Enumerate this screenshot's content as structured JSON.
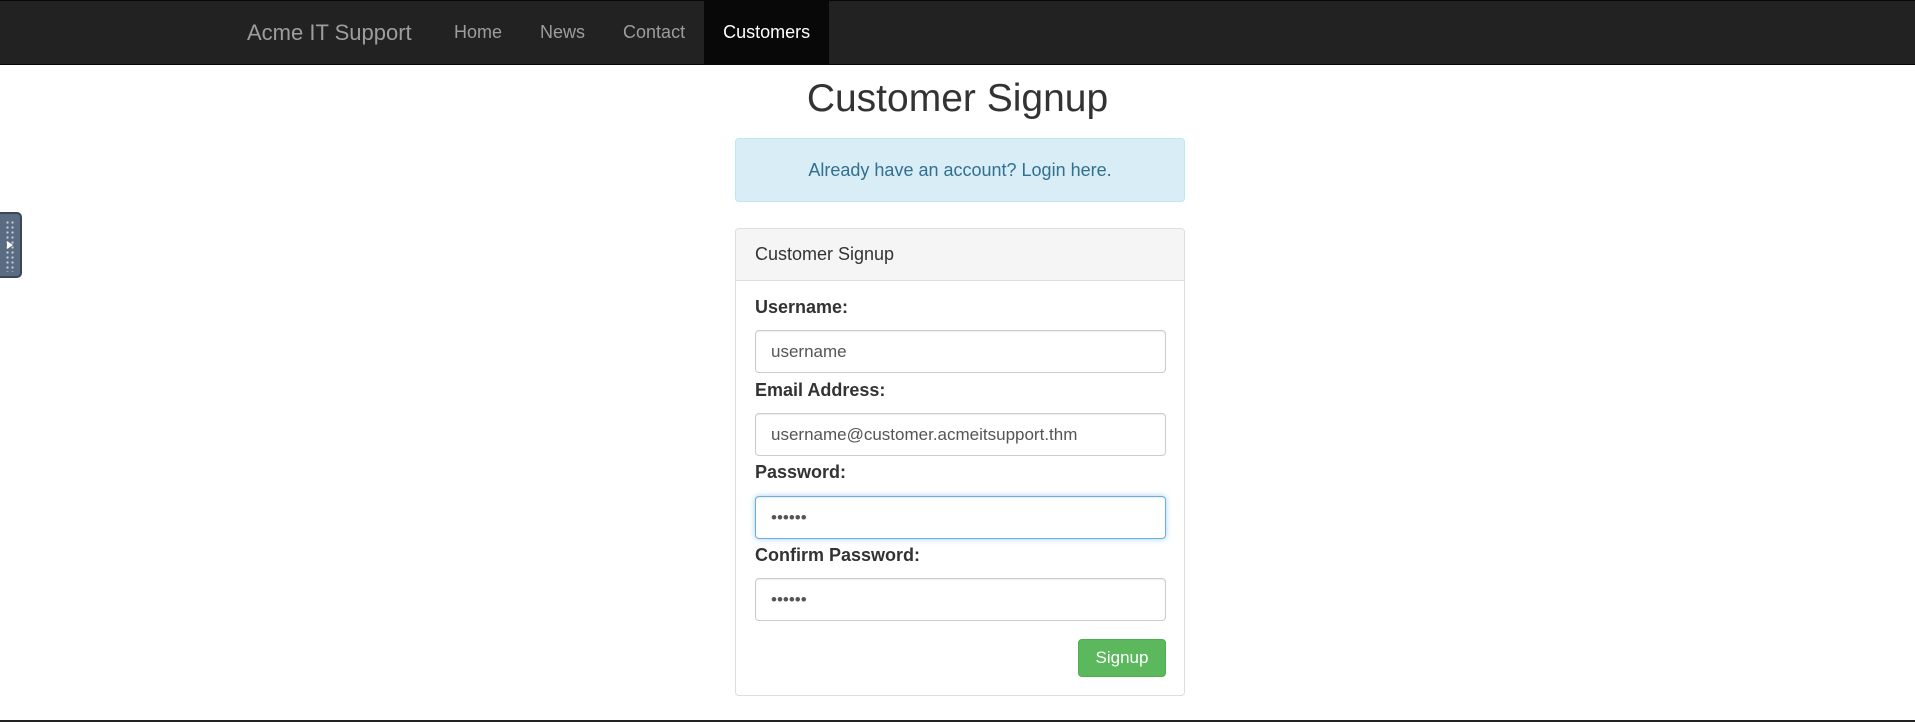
{
  "navbar": {
    "brand": "Acme IT Support",
    "items": [
      {
        "label": "Home",
        "active": false
      },
      {
        "label": "News",
        "active": false
      },
      {
        "label": "Contact",
        "active": false
      },
      {
        "label": "Customers",
        "active": true
      }
    ]
  },
  "page": {
    "title": "Customer Signup",
    "login_prompt": "Already have an account? Login here."
  },
  "form": {
    "heading": "Customer Signup",
    "username": {
      "label": "Username:",
      "placeholder": "username",
      "value": ""
    },
    "email": {
      "label": "Email Address:",
      "placeholder": "username@customer.acmeitsupport.thm",
      "value": ""
    },
    "password": {
      "label": "Password:",
      "value": "••••••"
    },
    "confirm_password": {
      "label": "Confirm Password:",
      "value": "••••••"
    },
    "submit_label": "Signup"
  },
  "colors": {
    "navbar_bg": "#222222",
    "nav_active_bg": "#080808",
    "alert_bg": "#d9edf7",
    "alert_text": "#31708f",
    "button_bg": "#5cb85c",
    "focus_border": "#66afe9"
  }
}
